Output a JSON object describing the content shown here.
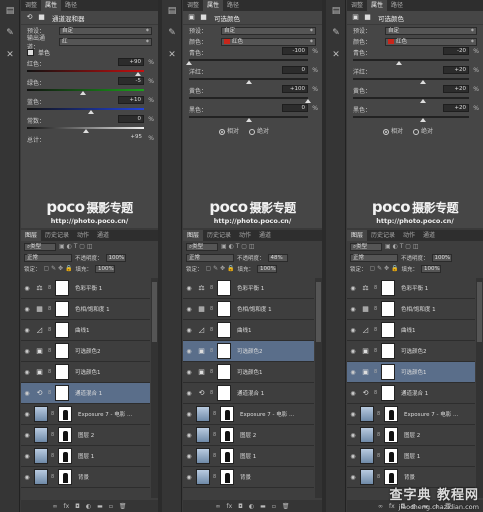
{
  "colors": {
    "panel_bg": "#464646",
    "selected_layer": "#5a6e8a",
    "swatch_red": "#c8261b"
  },
  "tabs_top": [
    "调整",
    "属性",
    "路径"
  ],
  "layers_tabs": [
    "图层",
    "历史记录",
    "动作",
    "通道"
  ],
  "panels": [
    {
      "title": "通道混和器",
      "preset_label": "预设：",
      "preset_value": "自定",
      "channel_label": "输出通道：",
      "channel_value": "红",
      "mono_label": "单色",
      "sliders": [
        {
          "name": "红色：",
          "value": "+90",
          "level": 0.95
        },
        {
          "name": "绿色：",
          "value": "-5",
          "level": 0.48
        },
        {
          "name": "蓝色：",
          "value": "+10",
          "level": 0.55
        },
        {
          "name": "常数：",
          "value": "0",
          "level": 0.5
        }
      ],
      "total_label": "总计：",
      "total_value": "+95",
      "pct": "%"
    },
    {
      "title": "可选颜色",
      "preset_label": "预设：",
      "preset_value": "自定",
      "color_label": "颜色：",
      "color_value": "红色",
      "sliders": [
        {
          "name": "青色：",
          "value": "-100",
          "level": 0.0
        },
        {
          "name": "洋红：",
          "value": "0",
          "level": 0.5
        },
        {
          "name": "黄色：",
          "value": "+100",
          "level": 1.0
        },
        {
          "name": "黑色：",
          "value": "0",
          "level": 0.5
        }
      ],
      "radio_relative": "相对",
      "radio_absolute": "绝对",
      "pct": "%"
    },
    {
      "title": "可选颜色",
      "preset_label": "预设：",
      "preset_value": "自定",
      "color_label": "颜色：",
      "color_value": "红色",
      "sliders": [
        {
          "name": "青色：",
          "value": "-20",
          "level": 0.4
        },
        {
          "name": "洋红：",
          "value": "+20",
          "level": 0.6
        },
        {
          "name": "黄色：",
          "value": "+20",
          "level": 0.6
        },
        {
          "name": "黑色：",
          "value": "+20",
          "level": 0.6
        }
      ],
      "radio_relative": "相对",
      "radio_absolute": "绝对",
      "pct": "%"
    }
  ],
  "watermark": {
    "logo": "poco",
    "logo_cn": "摄影专题",
    "url": "http://photo.poco.cn/"
  },
  "layer_controls": {
    "kind": "类型",
    "blend": "正常",
    "opacity_label": "不透明度：",
    "opacity_values": [
      "100%",
      "48%",
      "100%"
    ],
    "lock_label": "锁定：",
    "fill_label": "填充：",
    "fill_value": "100%"
  },
  "layers": [
    {
      "name": "色彩平衡 1",
      "icon": "balance-icon"
    },
    {
      "name": "色相/饱和度 1",
      "icon": "hue-icon"
    },
    {
      "name": "曲线1",
      "icon": "curves-icon"
    },
    {
      "name": "可选颜色2",
      "icon": "selective-icon"
    },
    {
      "name": "可选颜色1",
      "icon": "selective-icon"
    },
    {
      "name": "通道混合 1",
      "icon": "mixer-icon"
    },
    {
      "name": "Exposure 7 - 电影 ...",
      "icon": "photo"
    },
    {
      "name": "图层 2",
      "icon": "photo"
    },
    {
      "name": "图层 1",
      "icon": "photo"
    },
    {
      "name": "背景",
      "icon": "photo"
    }
  ],
  "selected_layers": [
    5,
    3,
    4
  ],
  "site_watermark": {
    "big": "查字典 教程网",
    "small": "jiaocheng.chazidian.com"
  }
}
